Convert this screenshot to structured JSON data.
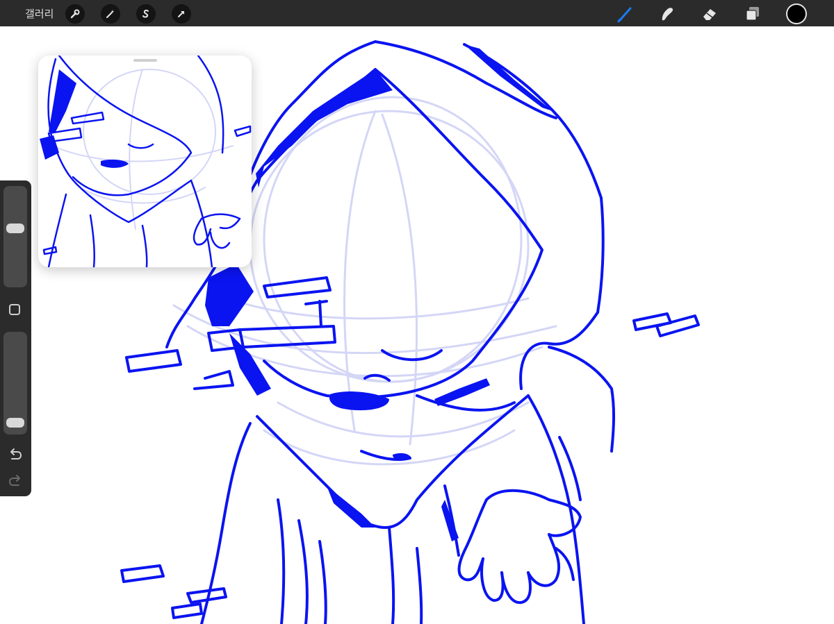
{
  "toolbar": {
    "gallery_label": "갤러리",
    "left_tools": [
      "wrench-icon",
      "magic-wand-icon",
      "selection-s-icon",
      "transform-arrow-icon"
    ],
    "right_tools": [
      "brush-icon",
      "smudge-icon",
      "eraser-icon",
      "layers-icon"
    ],
    "active_tool": "brush-icon",
    "active_color": "#000000",
    "accent_color": "#1a7cf5"
  },
  "sidebar": {
    "size_slider_value": 0.6,
    "opacity_slider_value": 0.05,
    "buttons": [
      "modify-square-icon",
      "undo-icon",
      "redo-icon"
    ]
  },
  "canvas": {
    "stroke_color": "#0a14f0",
    "sketch_color": "#d4d6f6"
  }
}
